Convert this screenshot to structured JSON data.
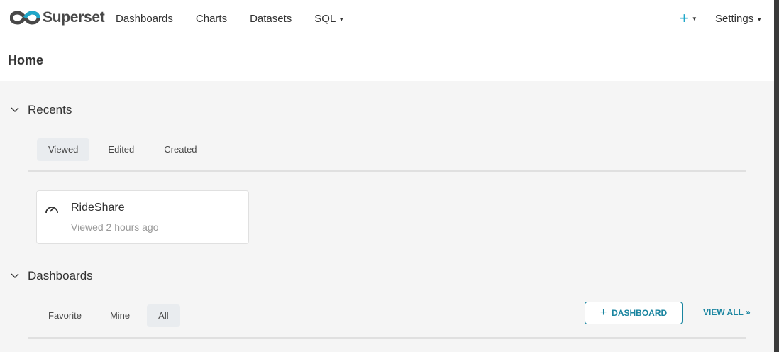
{
  "colors": {
    "accent": "#20a7c9",
    "primary_dark": "#1a85a0",
    "logo": "#484848"
  },
  "brand": {
    "name": "Superset",
    "icon": "infinity-logo"
  },
  "nav": {
    "dashboards": "Dashboards",
    "charts": "Charts",
    "datasets": "Datasets",
    "sql": "SQL"
  },
  "right_menu": {
    "plus": "+",
    "settings": "Settings"
  },
  "page": {
    "title": "Home"
  },
  "recents": {
    "title": "Recents",
    "tabs": [
      "Viewed",
      "Edited",
      "Created"
    ],
    "active_tab": "Viewed",
    "items": [
      {
        "title": "RideShare",
        "subtitle": "Viewed 2 hours ago",
        "icon": "dashboard-gauge-icon"
      }
    ]
  },
  "dashboards": {
    "title": "Dashboards",
    "tabs": [
      "Favorite",
      "Mine",
      "All"
    ],
    "active_tab": "All",
    "add_button": "DASHBOARD",
    "view_all": "VIEW ALL »"
  }
}
